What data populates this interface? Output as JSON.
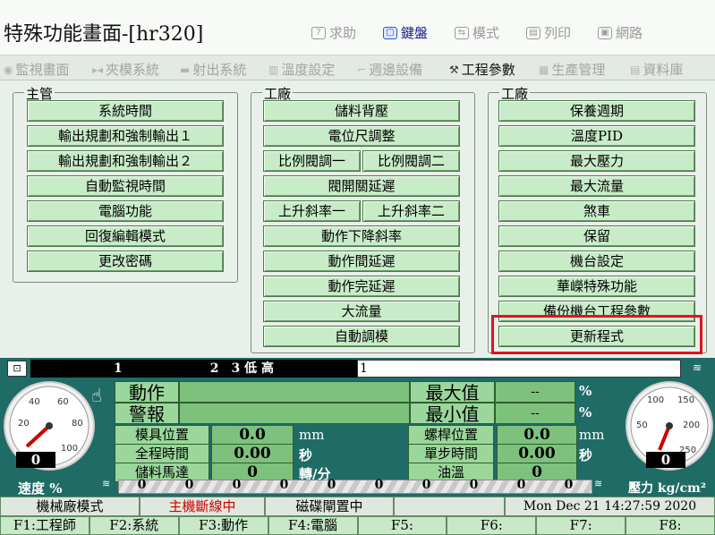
{
  "title": "特殊功能畫面-[hr320]",
  "top_buttons": [
    {
      "label": "求助",
      "icon": "help-icon",
      "active": false
    },
    {
      "label": "鍵盤",
      "icon": "keyboard-icon",
      "active": true
    },
    {
      "label": "模式",
      "icon": "mode-icon",
      "active": false
    },
    {
      "label": "列印",
      "icon": "printer-icon",
      "active": false
    },
    {
      "label": "網路",
      "icon": "network-icon",
      "active": false
    }
  ],
  "tabs": [
    "監視畫面",
    "夾模系統",
    "射出系統",
    "溫度設定",
    "週邊設備",
    "工程參數",
    "生產管理",
    "資料庫"
  ],
  "active_tab": "工程參數",
  "groups": {
    "left": {
      "label": "主管",
      "buttons": [
        "系統時間",
        "輸出規劃和強制輸出１",
        "輸出規劃和強制輸出２",
        "自動監視時間",
        "電腦功能",
        "回復編輯模式",
        "更改密碼"
      ]
    },
    "middle": {
      "label": "工廠",
      "buttons": [
        "儲料背壓",
        "電位尺調整",
        "比例閥調一",
        "比例閥調二",
        "閥開關延遲",
        "上升斜率一",
        "上升斜率二",
        "動作下降斜率",
        "動作間延遲",
        "動作完延遲",
        "大流量",
        "自動調模"
      ]
    },
    "right": {
      "label": "工廠",
      "buttons": [
        "保養週期",
        "溫度PID",
        "最大壓力",
        "最大流量",
        "煞車",
        "保留",
        "機台設定",
        "華嶸特殊功能",
        "備份機台工程參數",
        "更新程式"
      ]
    }
  },
  "status": {
    "bar_left": "1　　　　　　　2　3 低 高",
    "bar_right": "1",
    "action_label": "動作",
    "alarm_label": "警報",
    "max_label": "最大值",
    "min_label": "最小值",
    "max_value": "--",
    "min_value": "--",
    "percent": "%",
    "rows": [
      {
        "label": "模具位置",
        "value": "0.0",
        "unit": "mm",
        "label2": "螺桿位置",
        "value2": "0.0",
        "unit2": "mm"
      },
      {
        "label": "全程時間",
        "value": "0.00",
        "unit": "秒",
        "label2": "單步時間",
        "value2": "0.00",
        "unit2": "秒"
      },
      {
        "label": "儲料馬達",
        "value": "0",
        "unit": "轉/分",
        "label2": "油溫",
        "value2": "0",
        "unit2": ""
      }
    ],
    "left_gauge": {
      "ticks": [
        "20",
        "40",
        "60",
        "80",
        "100"
      ],
      "value": "0",
      "label": "速度 %"
    },
    "right_gauge": {
      "ticks": [
        "50",
        "100",
        "150",
        "200",
        "250"
      ],
      "value": "0",
      "label": "壓力 kg/cm²"
    },
    "speed_cells": [
      "0",
      "0",
      "0",
      "0",
      "0",
      "0",
      "0",
      "0",
      "0",
      "0"
    ]
  },
  "bottom": {
    "mode": "機械廠模式",
    "machine_status": "主機斷線中",
    "door_status": "磁碟閘置中",
    "datetime": "Mon Dec 21 14:27:59 2020"
  },
  "fkeys": [
    "F1:工程師",
    "F2:系統",
    "F3:動作",
    "F4:電腦",
    "F5:",
    "F6:",
    "F7:",
    "F8:"
  ]
}
